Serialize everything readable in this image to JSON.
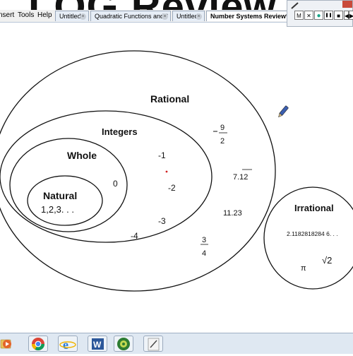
{
  "menubar": {
    "items": [
      "nsert",
      "Tools",
      "Help"
    ],
    "tabs": [
      {
        "label": "Untitled",
        "active": false
      },
      {
        "label": "Quadratic Functions and *",
        "active": false
      },
      {
        "label": "Untitled",
        "active": false
      },
      {
        "label": "Number Systems Review*",
        "active": true
      }
    ],
    "close_glyph": "×"
  },
  "controls": {
    "buttons": [
      "M",
      "✕",
      "●",
      "❚❚",
      "■",
      "◀",
      "▶"
    ],
    "pen_icon": "pen-icon"
  },
  "page": {
    "title": "LOG Review"
  },
  "diagram": {
    "sets": {
      "rational": "Rational",
      "integers": "Integers",
      "whole": "Whole",
      "natural": "Natural",
      "natural_examples": "1,2,3. . .",
      "irrational": "Irrational"
    },
    "numbers": {
      "neg_nine": "9",
      "two": "2",
      "neg_one": "-1",
      "zero": "0",
      "neg_two": "-2",
      "seven_twelve": "7.12",
      "eleven_twentythree": "11.23",
      "neg_three": "-3",
      "neg_four": "-4",
      "three": "3",
      "four": "4",
      "decimal": "2.1182818284 6. . .",
      "pi": "π",
      "sqrt_two": "√2"
    },
    "colors": {
      "ink": "#111111",
      "red_dot": "#d02020"
    }
  },
  "taskbar": {
    "icons": [
      "folder-icon",
      "media-player-icon",
      "chrome-icon",
      "internet-explorer-icon",
      "word-icon",
      "smartboard-icon",
      "notebook-icon"
    ]
  }
}
